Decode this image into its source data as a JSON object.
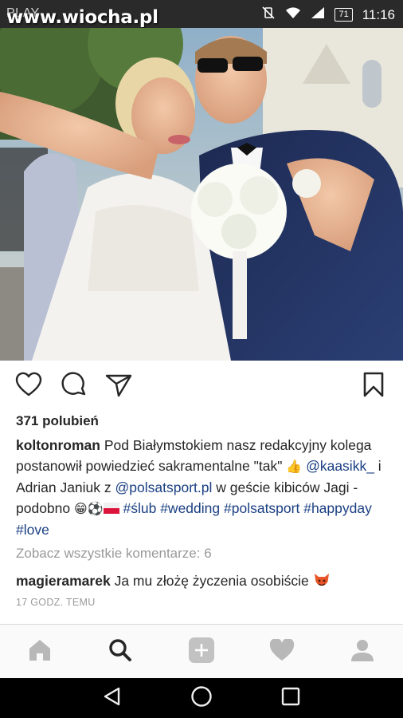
{
  "status_bar": {
    "carrier_label": "PLAY",
    "watermark": "www.wiocha.pl",
    "battery": "71",
    "time": "11:16"
  },
  "post": {
    "photo_alt": "wedding photo",
    "likes": "371 polubień",
    "author": "koltonroman",
    "caption": {
      "text1": " Pod Białymstokiem nasz redakcyjny kolega postanowił powiedzieć sakramentalne \"tak\" ",
      "emoji_thumb": "👍",
      "mention1": "@kaasikk_",
      "text2": " i Adrian Janiuk z ",
      "mention2": "@polsatsport.pl",
      "text3": " w geście kibiców Jagi - podobno ",
      "emoji_row": "😁⚽",
      "hashtag1": "#ślub",
      "hashtag2": "#wedding",
      "hashtag3": "#polsatsport",
      "hashtag4": "#happyday",
      "hashtag5": "#love"
    },
    "view_all_comments": "Zobacz wszystkie komentarze: 6",
    "comment": {
      "author": "magieramarek",
      "text": " Ja mu złożę życzenia osobiście "
    },
    "timestamp": "17 GODZ. TEMU"
  },
  "colors": {
    "hashtag": "#1a3f82",
    "muted": "#999999",
    "text": "#262626",
    "devil": "#e8572a"
  },
  "icons": {
    "like": "heart-icon",
    "comment": "comment-icon",
    "share": "send-icon",
    "save": "bookmark-icon",
    "home": "home-icon",
    "search": "search-icon",
    "add": "add-icon",
    "activity": "heart-icon",
    "profile": "profile-icon"
  }
}
